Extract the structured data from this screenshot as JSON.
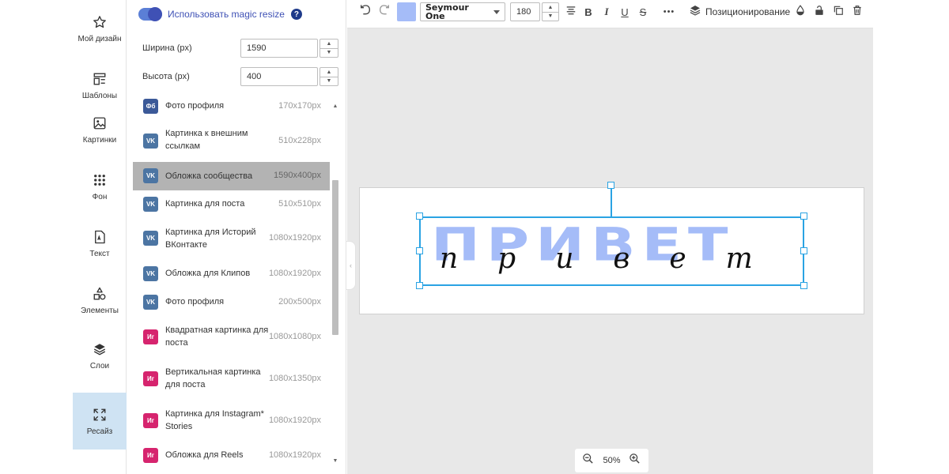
{
  "sidebar": {
    "items": [
      {
        "label": "Мой дизайн",
        "icon": "star-icon"
      },
      {
        "label": "Шаблоны",
        "icon": "templates-icon"
      },
      {
        "label": "Картинки",
        "icon": "image-icon"
      },
      {
        "label": "Фон",
        "icon": "dots-grid-icon"
      },
      {
        "label": "Текст",
        "icon": "text-doc-icon"
      },
      {
        "label": "Элементы",
        "icon": "shapes-icon"
      },
      {
        "label": "Слои",
        "icon": "layers-icon"
      },
      {
        "label": "Ресайз",
        "icon": "resize-icon"
      }
    ]
  },
  "resize_panel": {
    "magic_resize_label": "Использовать magic resize",
    "magic_resize_enabled": true,
    "width_label": "Ширина (px)",
    "width_value": "1590",
    "height_label": "Высота (px)",
    "height_value": "400",
    "formats": [
      {
        "badge": "Фб",
        "badge_color": "#3b5998",
        "name": "Фото профиля",
        "size": "170x170px"
      },
      {
        "badge": "VK",
        "badge_color": "#4c75a3",
        "name": "Картинка к внешним ссылкам",
        "size": "510x228px"
      },
      {
        "badge": "VK",
        "badge_color": "#4c75a3",
        "name": "Обложка сообщества",
        "size": "1590x400px",
        "selected": true
      },
      {
        "badge": "VK",
        "badge_color": "#4c75a3",
        "name": "Картинка для поста",
        "size": "510x510px"
      },
      {
        "badge": "VK",
        "badge_color": "#4c75a3",
        "name": "Картинка для Историй ВКонтакте",
        "size": "1080x1920px"
      },
      {
        "badge": "VK",
        "badge_color": "#4c75a3",
        "name": "Обложка для Клипов",
        "size": "1080x1920px"
      },
      {
        "badge": "VK",
        "badge_color": "#4c75a3",
        "name": "Фото профиля",
        "size": "200x500px"
      },
      {
        "badge": "Иг",
        "badge_color": "#d6246e",
        "name": "Квадратная картинка для поста",
        "size": "1080x1080px"
      },
      {
        "badge": "Иг",
        "badge_color": "#d6246e",
        "name": "Вертикальная картинка для поста",
        "size": "1080x1350px"
      },
      {
        "badge": "Иг",
        "badge_color": "#d6246e",
        "name": "Картинка для Instagram* Stories",
        "size": "1080x1920px"
      },
      {
        "badge": "Иг",
        "badge_color": "#d6246e",
        "name": "Обложка для Reels",
        "size": "1080x1920px"
      }
    ]
  },
  "toolbar": {
    "undo_icon": "undo-icon",
    "redo_icon": "redo-icon",
    "text_color": "#a5bcf8",
    "font_name": "Seymour One",
    "font_size": "180",
    "bold": "B",
    "italic": "I",
    "underline": "U",
    "strike": "S",
    "more": "•••",
    "position_label": "Позиционирование"
  },
  "canvas": {
    "big_text": "ПРИВЕТ",
    "script_text": "привет",
    "zoom": "50%"
  }
}
